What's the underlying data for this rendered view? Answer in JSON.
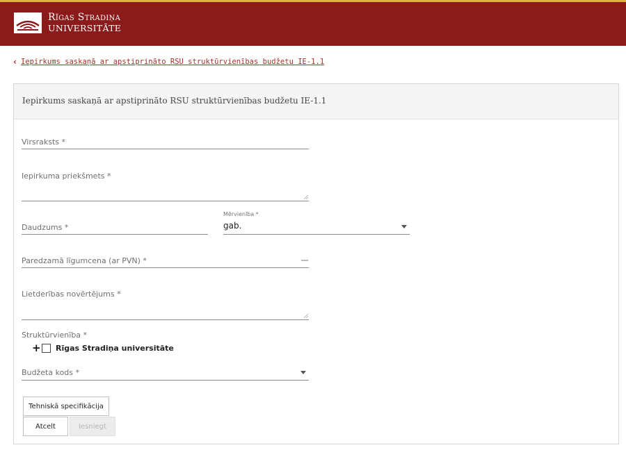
{
  "header": {
    "brand_line1": "Rīgas Stradiņa",
    "brand_line2": "universitāte",
    "bg_color": "#8b1a1a",
    "accent_color": "#e0b23a"
  },
  "breadcrumb": {
    "icon": "chevron-left-icon",
    "text": "Iepirkums saskaņā ar apstiprināto RSU struktūrvienības budžetu IE-1.1"
  },
  "form": {
    "title": "Iepirkums saskaņā ar apstiprināto RSU struktūrvienības budžetu IE-1.1",
    "fields": {
      "virsraksts": {
        "label": "Virsraksts *",
        "value": ""
      },
      "priekshmets": {
        "label": "Iepirkuma priekšmets *",
        "value": ""
      },
      "daudzums": {
        "label": "Daudzums *",
        "value": ""
      },
      "mervieniba": {
        "label": "Mērvienība *",
        "value": "gab."
      },
      "ligumcena": {
        "label": "Paredzamā līgumcena (ar PVN) *",
        "value": ""
      },
      "lietderiba": {
        "label": "Lietderības novērtējums *",
        "value": ""
      },
      "strukturvieniba": {
        "label": "Struktūrvienība  *",
        "tree_item": "Rīgas Stradiņa universitāte"
      },
      "budzeta_kods": {
        "label": "Budžeta kods *",
        "value": ""
      }
    },
    "buttons": {
      "spec": "Tehniskā specifikācija",
      "cancel": "Atcelt",
      "submit": "Iesniegt"
    }
  }
}
